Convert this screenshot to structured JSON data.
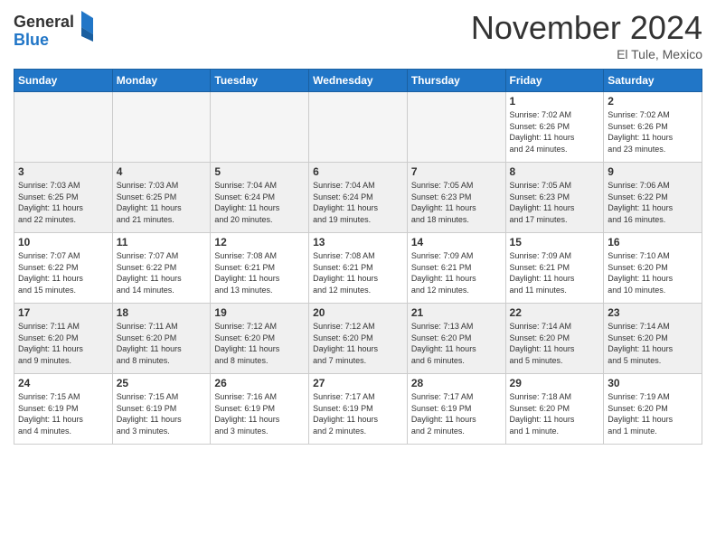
{
  "header": {
    "logo_general": "General",
    "logo_blue": "Blue",
    "month_title": "November 2024",
    "location": "El Tule, Mexico"
  },
  "days_of_week": [
    "Sunday",
    "Monday",
    "Tuesday",
    "Wednesday",
    "Thursday",
    "Friday",
    "Saturday"
  ],
  "weeks": [
    [
      {
        "day": "",
        "info": "",
        "empty": true
      },
      {
        "day": "",
        "info": "",
        "empty": true
      },
      {
        "day": "",
        "info": "",
        "empty": true
      },
      {
        "day": "",
        "info": "",
        "empty": true
      },
      {
        "day": "",
        "info": "",
        "empty": true
      },
      {
        "day": "1",
        "info": "Sunrise: 7:02 AM\nSunset: 6:26 PM\nDaylight: 11 hours\nand 24 minutes."
      },
      {
        "day": "2",
        "info": "Sunrise: 7:02 AM\nSunset: 6:26 PM\nDaylight: 11 hours\nand 23 minutes."
      }
    ],
    [
      {
        "day": "3",
        "info": "Sunrise: 7:03 AM\nSunset: 6:25 PM\nDaylight: 11 hours\nand 22 minutes."
      },
      {
        "day": "4",
        "info": "Sunrise: 7:03 AM\nSunset: 6:25 PM\nDaylight: 11 hours\nand 21 minutes."
      },
      {
        "day": "5",
        "info": "Sunrise: 7:04 AM\nSunset: 6:24 PM\nDaylight: 11 hours\nand 20 minutes."
      },
      {
        "day": "6",
        "info": "Sunrise: 7:04 AM\nSunset: 6:24 PM\nDaylight: 11 hours\nand 19 minutes."
      },
      {
        "day": "7",
        "info": "Sunrise: 7:05 AM\nSunset: 6:23 PM\nDaylight: 11 hours\nand 18 minutes."
      },
      {
        "day": "8",
        "info": "Sunrise: 7:05 AM\nSunset: 6:23 PM\nDaylight: 11 hours\nand 17 minutes."
      },
      {
        "day": "9",
        "info": "Sunrise: 7:06 AM\nSunset: 6:22 PM\nDaylight: 11 hours\nand 16 minutes."
      }
    ],
    [
      {
        "day": "10",
        "info": "Sunrise: 7:07 AM\nSunset: 6:22 PM\nDaylight: 11 hours\nand 15 minutes."
      },
      {
        "day": "11",
        "info": "Sunrise: 7:07 AM\nSunset: 6:22 PM\nDaylight: 11 hours\nand 14 minutes."
      },
      {
        "day": "12",
        "info": "Sunrise: 7:08 AM\nSunset: 6:21 PM\nDaylight: 11 hours\nand 13 minutes."
      },
      {
        "day": "13",
        "info": "Sunrise: 7:08 AM\nSunset: 6:21 PM\nDaylight: 11 hours\nand 12 minutes."
      },
      {
        "day": "14",
        "info": "Sunrise: 7:09 AM\nSunset: 6:21 PM\nDaylight: 11 hours\nand 12 minutes."
      },
      {
        "day": "15",
        "info": "Sunrise: 7:09 AM\nSunset: 6:21 PM\nDaylight: 11 hours\nand 11 minutes."
      },
      {
        "day": "16",
        "info": "Sunrise: 7:10 AM\nSunset: 6:20 PM\nDaylight: 11 hours\nand 10 minutes."
      }
    ],
    [
      {
        "day": "17",
        "info": "Sunrise: 7:11 AM\nSunset: 6:20 PM\nDaylight: 11 hours\nand 9 minutes."
      },
      {
        "day": "18",
        "info": "Sunrise: 7:11 AM\nSunset: 6:20 PM\nDaylight: 11 hours\nand 8 minutes."
      },
      {
        "day": "19",
        "info": "Sunrise: 7:12 AM\nSunset: 6:20 PM\nDaylight: 11 hours\nand 8 minutes."
      },
      {
        "day": "20",
        "info": "Sunrise: 7:12 AM\nSunset: 6:20 PM\nDaylight: 11 hours\nand 7 minutes."
      },
      {
        "day": "21",
        "info": "Sunrise: 7:13 AM\nSunset: 6:20 PM\nDaylight: 11 hours\nand 6 minutes."
      },
      {
        "day": "22",
        "info": "Sunrise: 7:14 AM\nSunset: 6:20 PM\nDaylight: 11 hours\nand 5 minutes."
      },
      {
        "day": "23",
        "info": "Sunrise: 7:14 AM\nSunset: 6:20 PM\nDaylight: 11 hours\nand 5 minutes."
      }
    ],
    [
      {
        "day": "24",
        "info": "Sunrise: 7:15 AM\nSunset: 6:19 PM\nDaylight: 11 hours\nand 4 minutes."
      },
      {
        "day": "25",
        "info": "Sunrise: 7:15 AM\nSunset: 6:19 PM\nDaylight: 11 hours\nand 3 minutes."
      },
      {
        "day": "26",
        "info": "Sunrise: 7:16 AM\nSunset: 6:19 PM\nDaylight: 11 hours\nand 3 minutes."
      },
      {
        "day": "27",
        "info": "Sunrise: 7:17 AM\nSunset: 6:19 PM\nDaylight: 11 hours\nand 2 minutes."
      },
      {
        "day": "28",
        "info": "Sunrise: 7:17 AM\nSunset: 6:19 PM\nDaylight: 11 hours\nand 2 minutes."
      },
      {
        "day": "29",
        "info": "Sunrise: 7:18 AM\nSunset: 6:20 PM\nDaylight: 11 hours\nand 1 minute."
      },
      {
        "day": "30",
        "info": "Sunrise: 7:19 AM\nSunset: 6:20 PM\nDaylight: 11 hours\nand 1 minute."
      }
    ]
  ]
}
